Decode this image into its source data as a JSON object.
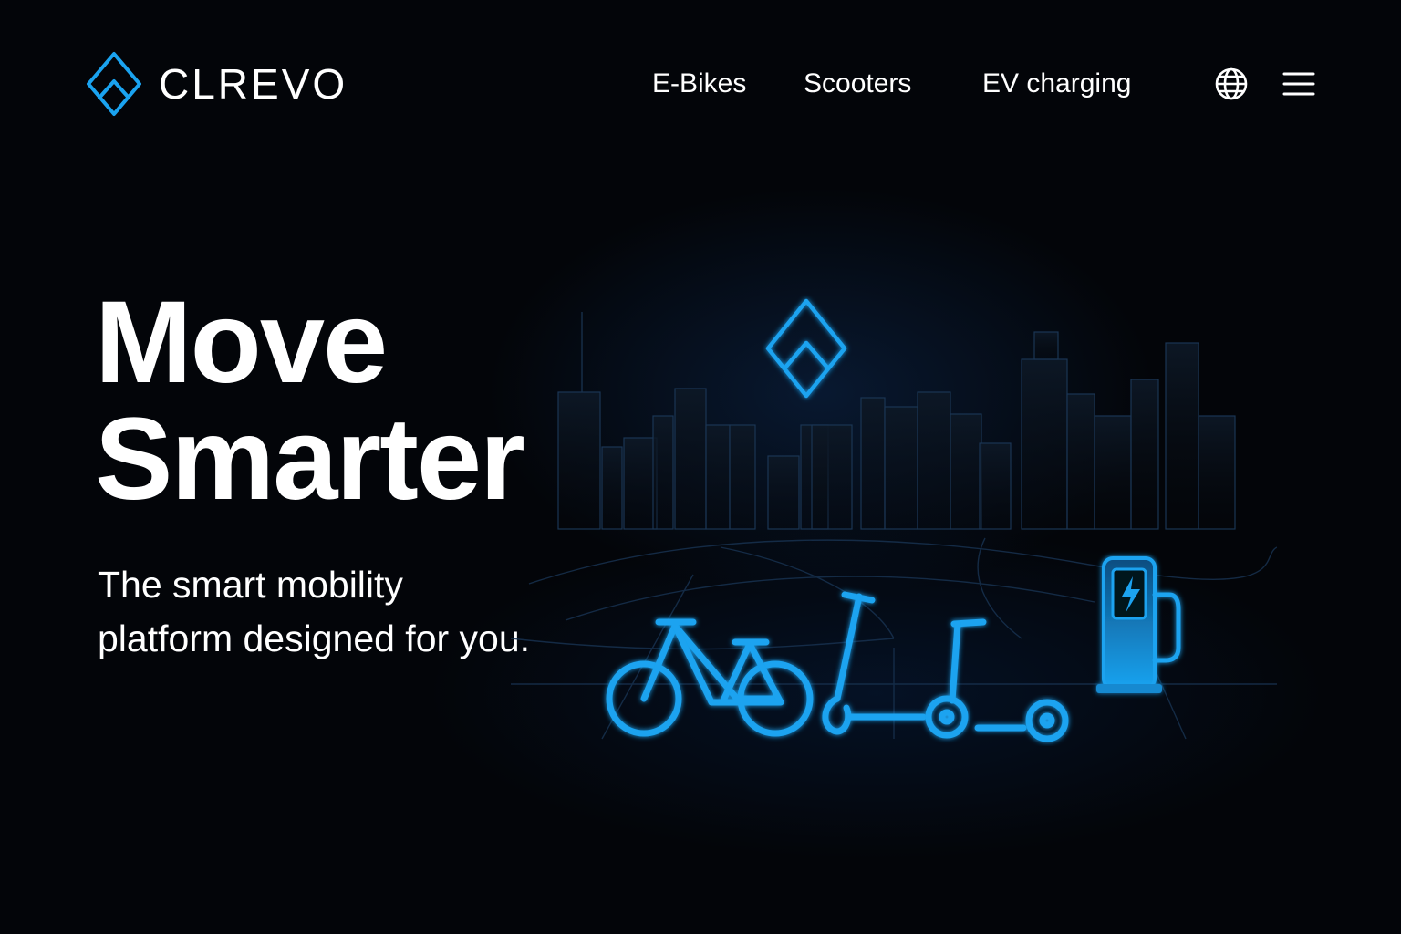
{
  "brand": {
    "name": "CLREVO",
    "logo_icon": "diamond-chevron-logo-icon",
    "accent_color": "#1aa3f0"
  },
  "nav": {
    "links": [
      {
        "label": "E-Bikes"
      },
      {
        "label": "Scooters"
      },
      {
        "label": "EV charging"
      }
    ],
    "icons": [
      "globe-icon",
      "hamburger-menu-icon"
    ]
  },
  "hero": {
    "title_line1": "Move",
    "title_line2": "Smarter",
    "subtitle_line1": "The smart mobility",
    "subtitle_line2": "platform designed for you."
  },
  "illustration": {
    "elements": [
      "city-skyline",
      "floating-logo-icon",
      "bicycle-icon",
      "kick-scooter-icon",
      "folded-scooter-icon",
      "ev-charger-icon",
      "road-grid"
    ]
  },
  "colors": {
    "background": "#030509",
    "accent": "#1aa3f0",
    "text": "#ffffff"
  }
}
